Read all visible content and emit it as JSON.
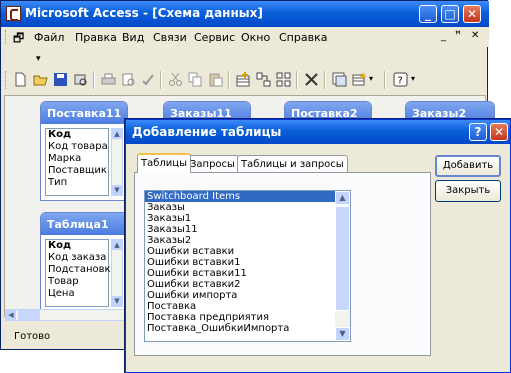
{
  "window": {
    "title": "Microsoft Access - [Схема данных]"
  },
  "menu": {
    "items": [
      "Файл",
      "Правка",
      "Вид",
      "Связи",
      "Сервис",
      "Окно",
      "Справка"
    ]
  },
  "tables": [
    {
      "name": "Поставка11",
      "fields": [
        "Код",
        "Код товара",
        "Марка",
        "Поставщик",
        "Тип"
      ]
    },
    {
      "name": "Заказы11",
      "fields": []
    },
    {
      "name": "Поставка2",
      "fields": []
    },
    {
      "name": "Заказы2",
      "fields": []
    },
    {
      "name": "Таблица1",
      "fields": [
        "Код",
        "Код заказа",
        "Подстановка",
        "Товар",
        "Цена"
      ]
    }
  ],
  "status": {
    "text": "Готово"
  },
  "dialog": {
    "title": "Добавление таблицы",
    "help_btn": "?",
    "tabs": [
      "Таблицы",
      "Запросы",
      "Таблицы и запросы"
    ],
    "list": [
      "Switchboard Items",
      "Заказы",
      "Заказы1",
      "Заказы11",
      "Заказы2",
      "Ошибки вставки",
      "Ошибки вставки1",
      "Ошибки вставки11",
      "Ошибки вставки2",
      "Ошибки импорта",
      "Поставка",
      "Поставка предприятия",
      "Поставка_ОшибкиИмпорта"
    ],
    "selected_index": 0,
    "add_button": "Добавить",
    "close_button": "Закрыть"
  }
}
